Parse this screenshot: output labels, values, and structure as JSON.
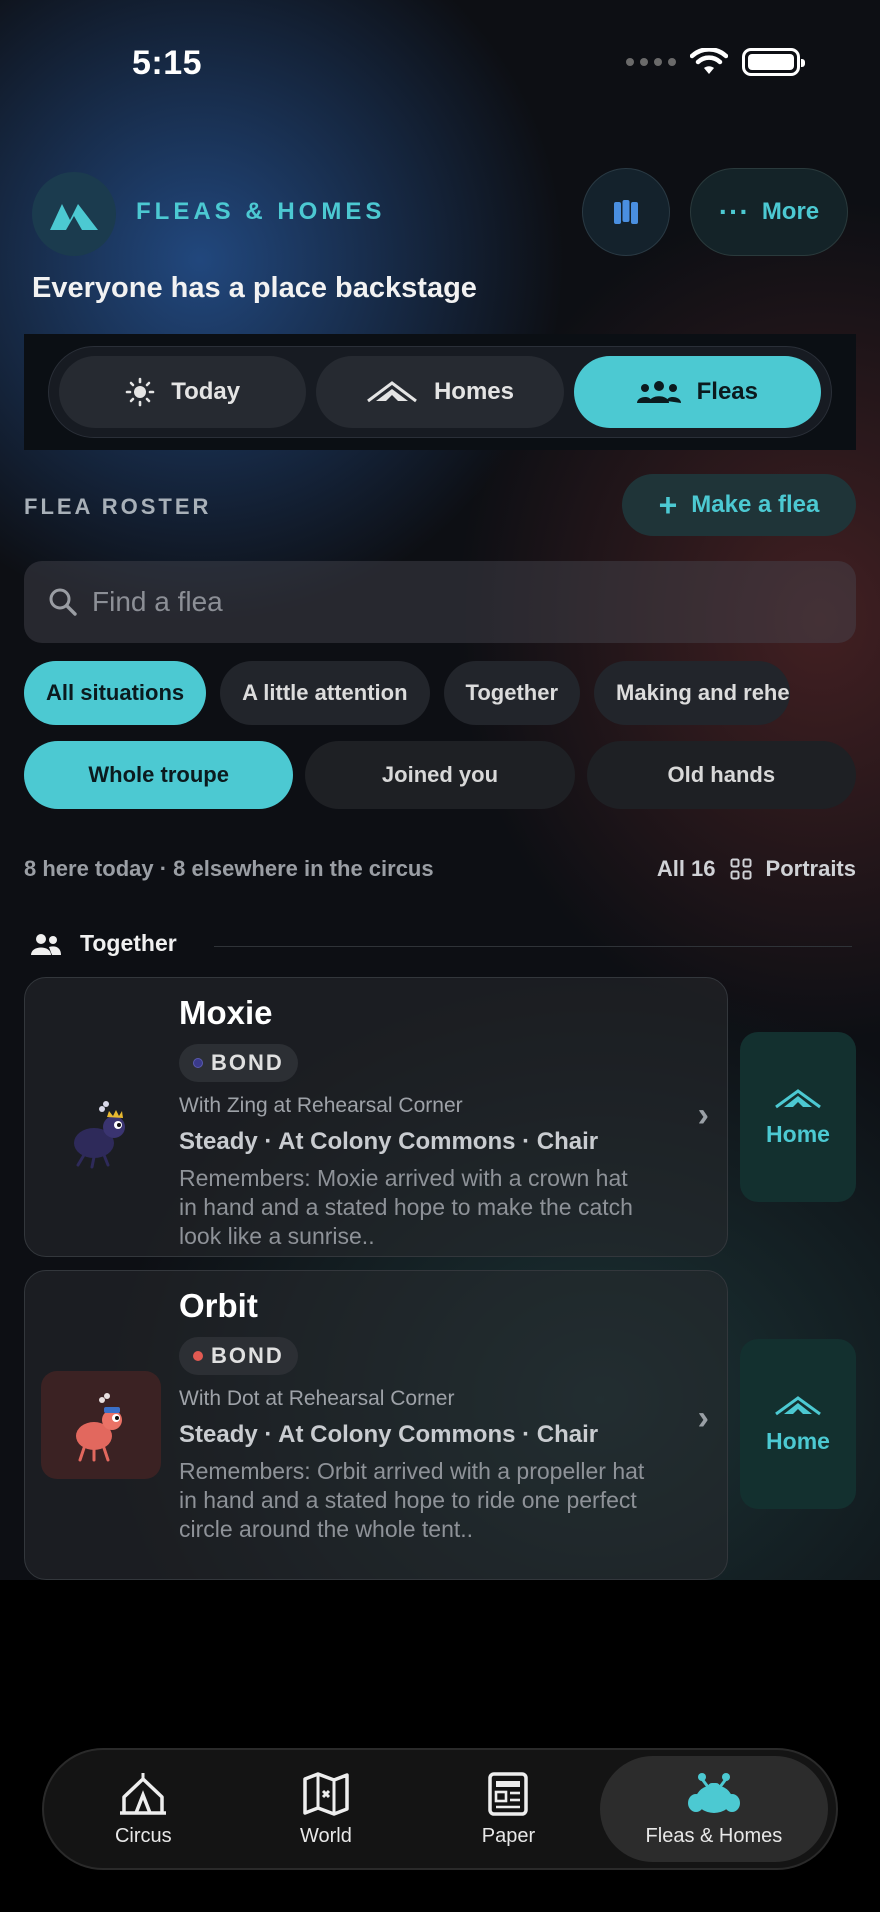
{
  "status": {
    "time": "5:15"
  },
  "header": {
    "brand": "FLEAS & HOMES",
    "tagline": "Everyone has a place backstage",
    "more_label": "More"
  },
  "segments": [
    {
      "label": "Today",
      "icon": "sun-icon",
      "active": false
    },
    {
      "label": "Homes",
      "icon": "tent-icon",
      "active": false
    },
    {
      "label": "Fleas",
      "icon": "group-icon",
      "active": true
    }
  ],
  "roster": {
    "label": "FLEA ROSTER",
    "make_label": "Make a flea",
    "search_placeholder": "Find a flea"
  },
  "chips": [
    {
      "label": "All situations",
      "active": true
    },
    {
      "label": "A little attention",
      "active": false
    },
    {
      "label": "Together",
      "active": false
    },
    {
      "label": "Making and rehe",
      "active": false
    }
  ],
  "filters": [
    {
      "label": "Whole troupe",
      "active": true
    },
    {
      "label": "Joined you",
      "active": false
    },
    {
      "label": "Old hands",
      "active": false
    }
  ],
  "meta": {
    "summary": "8 here today · 8 elsewhere in the circus",
    "all_count": "All 16",
    "view_label": "Portraits"
  },
  "section": {
    "title": "Together"
  },
  "fleas": [
    {
      "name": "Moxie",
      "badge": "BOND",
      "badge_dot_color": "#3a3a8a",
      "with": "With Zing at Rehearsal Corner",
      "status": "Steady · At Colony Commons · Chair",
      "memory": "Remembers: Moxie arrived with a crown hat in hand and a stated hope to make the catch look like a sunrise..",
      "home_label": "Home"
    },
    {
      "name": "Orbit",
      "badge": "BOND",
      "badge_dot_color": "#e25a52",
      "with": "With Dot at Rehearsal Corner",
      "status": "Steady · At Colony Commons · Chair",
      "memory": "Remembers: Orbit arrived with a propeller hat in hand and a stated hope to ride one perfect circle around the whole tent..",
      "home_label": "Home"
    }
  ],
  "tabs": [
    {
      "label": "Circus",
      "icon": "circus-tent-icon",
      "active": false
    },
    {
      "label": "World",
      "icon": "world-map-icon",
      "active": false
    },
    {
      "label": "Paper",
      "icon": "newspaper-icon",
      "active": false
    },
    {
      "label": "Fleas & Homes",
      "icon": "flea-icon",
      "active": true
    }
  ],
  "colors": {
    "accent": "#4cc9d2",
    "background": "#0d0f14"
  }
}
